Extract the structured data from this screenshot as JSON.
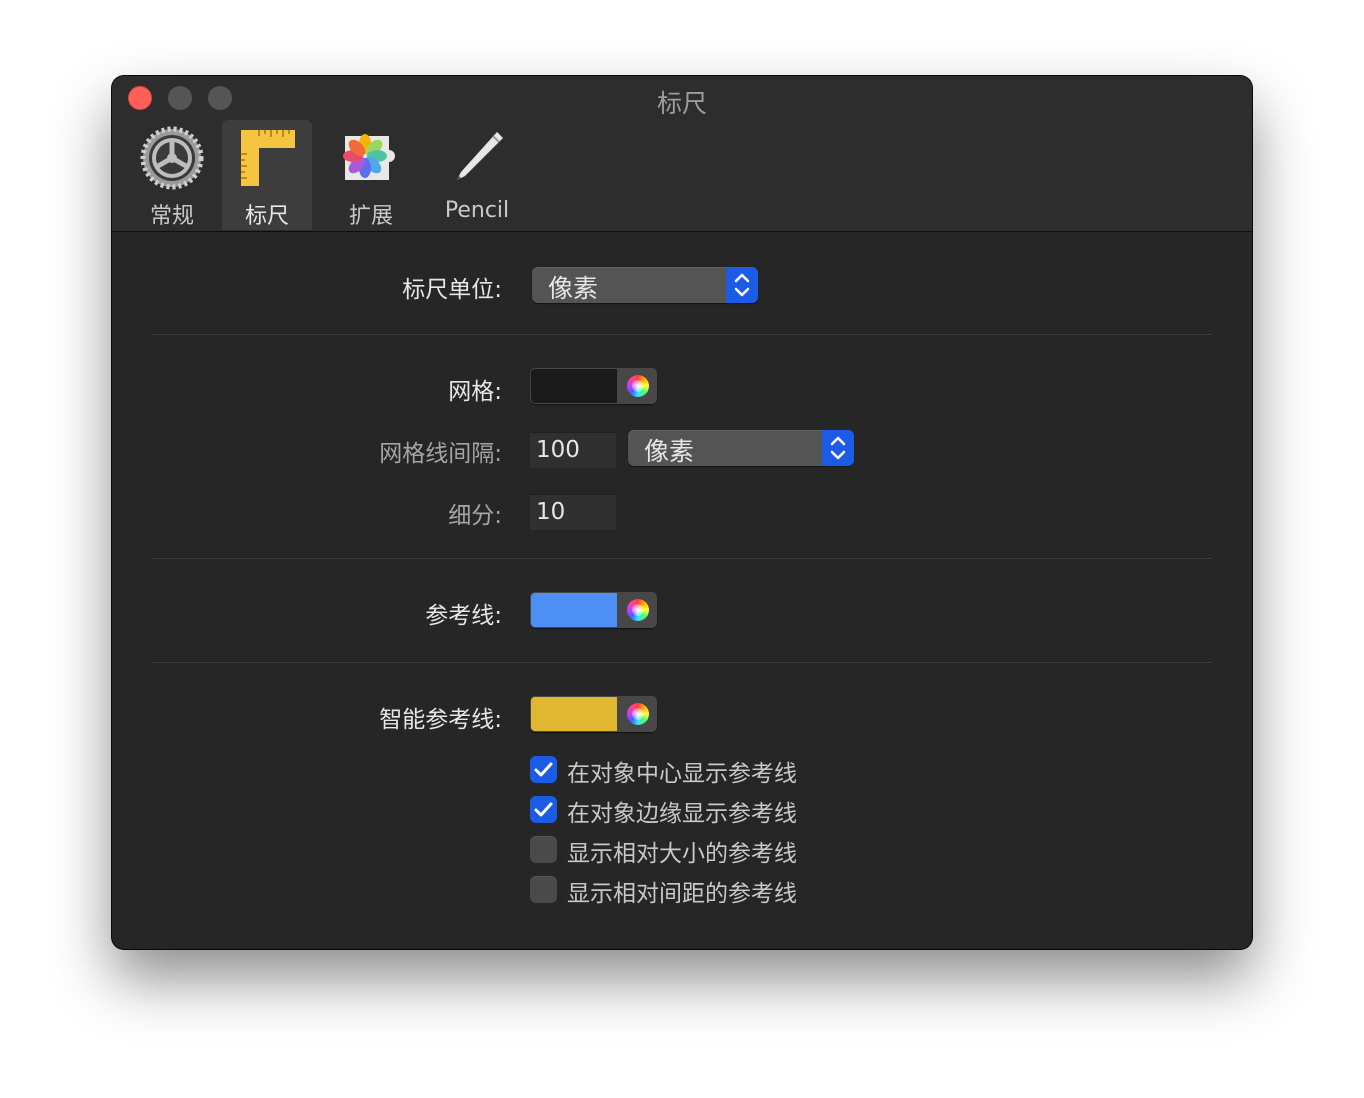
{
  "window": {
    "title": "标尺"
  },
  "toolbar": {
    "tabs": [
      {
        "label": "常规",
        "icon": "gear-icon"
      },
      {
        "label": "标尺",
        "icon": "ruler-icon",
        "active": true
      },
      {
        "label": "扩展",
        "icon": "extensions-puzzle-icon"
      },
      {
        "label": "Pencil",
        "icon": "pencil-icon"
      }
    ]
  },
  "ruler_units": {
    "label": "标尺单位:",
    "value": "像素"
  },
  "grid": {
    "label": "网格:",
    "color": "#1a1a1a",
    "spacing_label": "网格线间隔:",
    "spacing_value": "100",
    "spacing_unit": "像素",
    "subdivision_label": "细分:",
    "subdivision_value": "10"
  },
  "guides": {
    "label": "参考线:",
    "color": "#4d8ff5"
  },
  "smart_guides": {
    "label": "智能参考线:",
    "color": "#dfb730",
    "options": [
      {
        "label": "在对象中心显示参考线",
        "checked": true
      },
      {
        "label": "在对象边缘显示参考线",
        "checked": true
      },
      {
        "label": "显示相对大小的参考线",
        "checked": false
      },
      {
        "label": "显示相对间距的参考线",
        "checked": false
      }
    ]
  },
  "colors": {
    "accent": "#1b5be5",
    "window_bg": "#262626"
  }
}
